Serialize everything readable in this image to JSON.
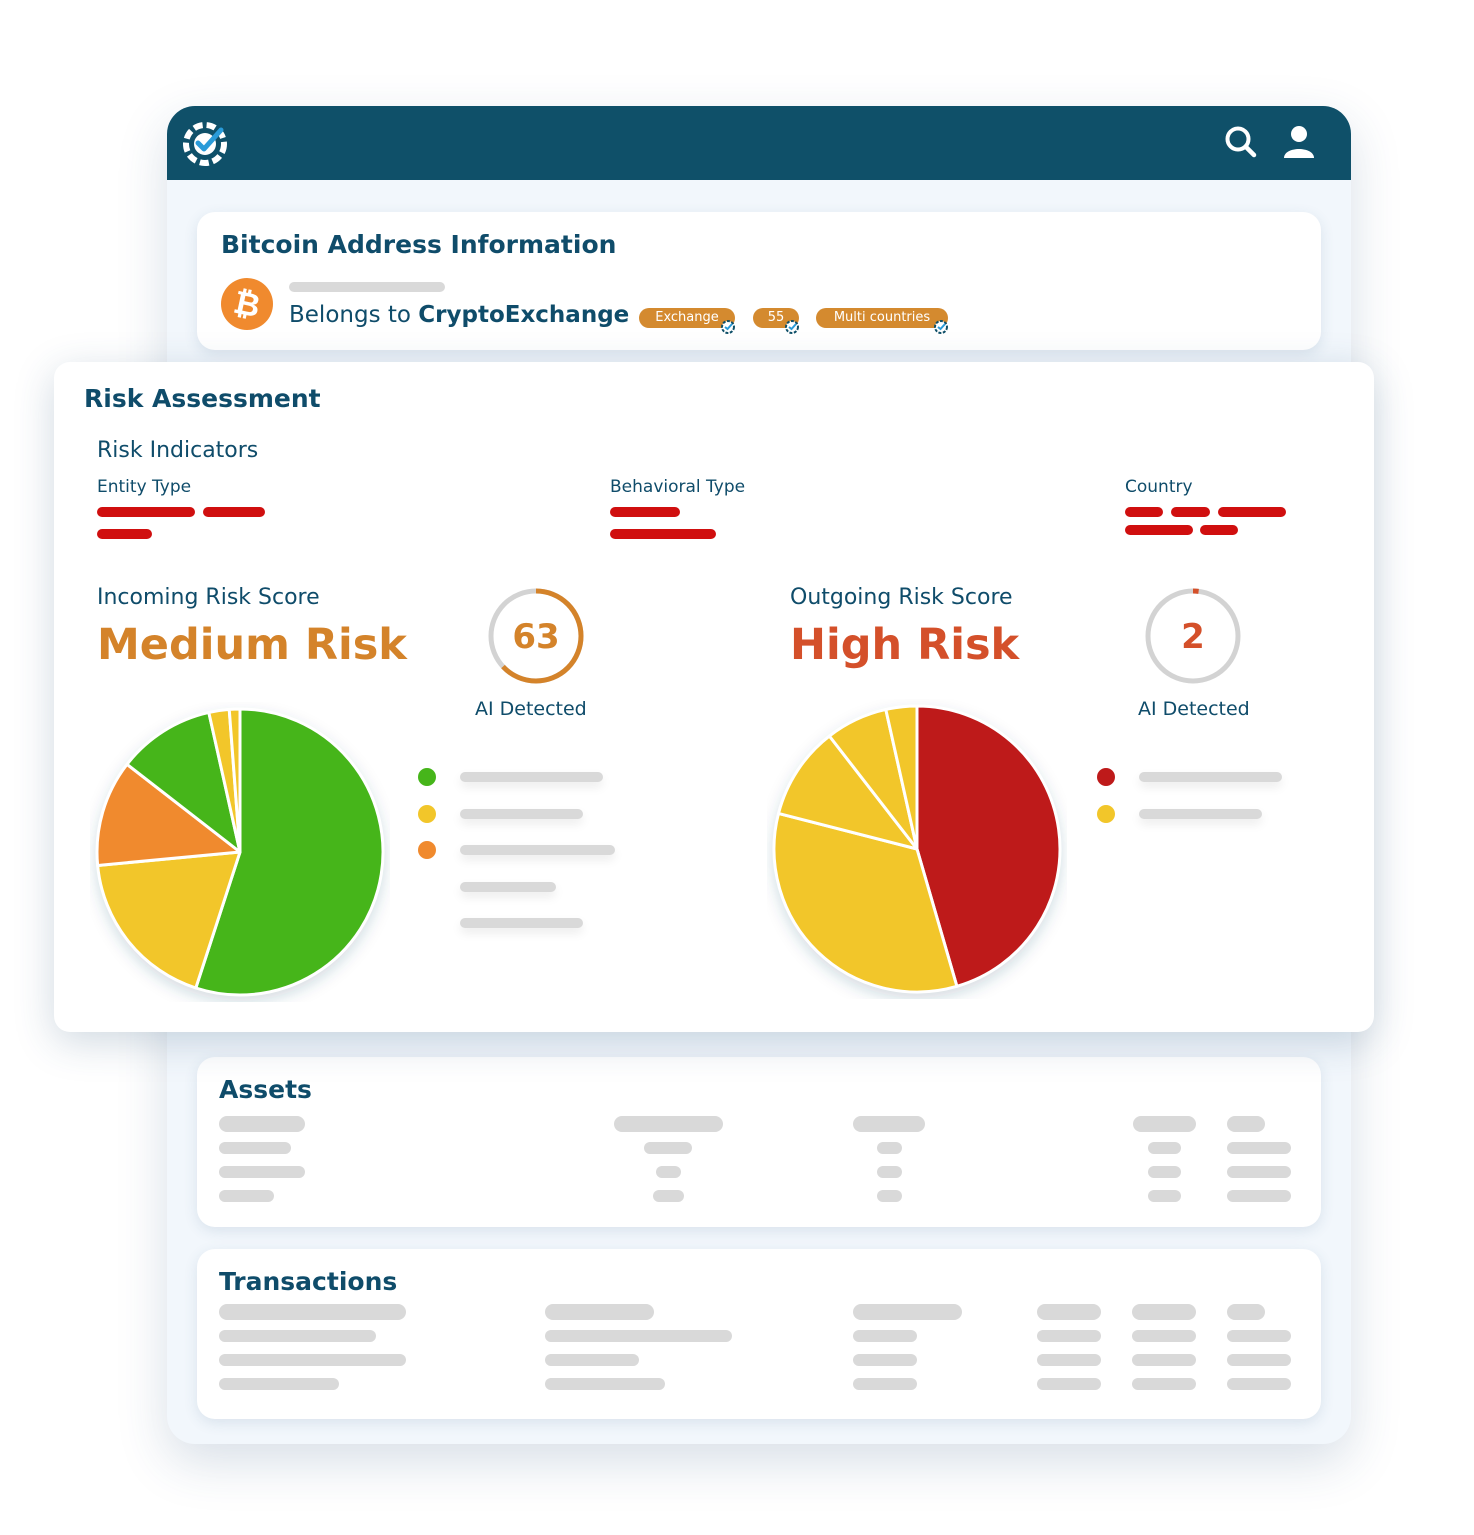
{
  "colors": {
    "navy": "#0f5069",
    "title_text": "#0f4c6a",
    "tag_orange": "#d48a2f",
    "medium_risk": "#d4832a",
    "high_risk": "#d4502a",
    "green": "#46b51a",
    "yellow": "#f2c62a",
    "orange": "#f08a2e",
    "red": "#be1a1a",
    "redacted": "#d00f0f",
    "placeholder_gray": "#d9d9d9"
  },
  "header": {
    "logo_icon": "check-circle-logo",
    "search_icon": "search-icon",
    "user_icon": "user-icon"
  },
  "address_info": {
    "title": "Bitcoin Address Information",
    "icon": "bitcoin-icon",
    "belongs_prefix": "Belongs to ",
    "owner": "CryptoExchange",
    "tags": [
      "Exchange",
      "55",
      "Multi countries"
    ]
  },
  "risk_assessment": {
    "title": "Risk Assessment",
    "indicators_title": "Risk Indicators",
    "entity_type_label": "Entity Type",
    "behavioral_type_label": "Behavioral Type",
    "country_label": "Country",
    "incoming": {
      "label": "Incoming Risk Score",
      "level": "Medium Risk",
      "score": "63",
      "score_fraction": 0.63,
      "ai_label": "AI Detected",
      "pie_percent": [
        55,
        18.5,
        12,
        11,
        2.3,
        1.2
      ],
      "pie_colors": [
        "#46b51a",
        "#f2c62a",
        "#f08a2e",
        "#46b51a",
        "#f2c62a",
        "#f2c62a"
      ],
      "legend_colors": [
        "#46b51a",
        "#f2c62a",
        "#f08a2e"
      ]
    },
    "outgoing": {
      "label": "Outgoing Risk Score",
      "level": "High Risk",
      "score": "2",
      "score_fraction": 0.02,
      "ai_label": "AI Detected",
      "pie_percent": [
        45.5,
        33.5,
        10.5,
        7,
        3.5
      ],
      "pie_colors": [
        "#be1a1a",
        "#f2c62a",
        "#f2c62a",
        "#f2c62a",
        "#f2c62a"
      ],
      "legend_colors": [
        "#be1a1a",
        "#f2c62a"
      ]
    }
  },
  "assets": {
    "title": "Assets"
  },
  "transactions": {
    "title": "Transactions"
  }
}
